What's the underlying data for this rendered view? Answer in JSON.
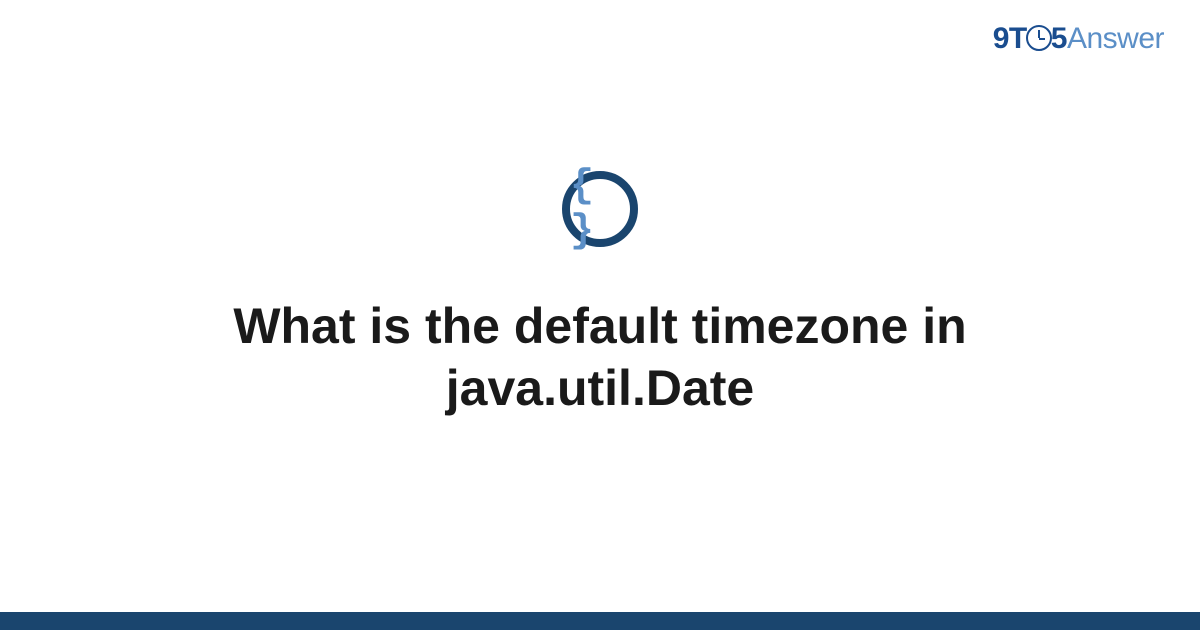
{
  "brand": {
    "segment_9t": "9T",
    "segment_5": "5",
    "segment_answer": "Answer"
  },
  "icon": {
    "glyph": "{ }"
  },
  "question": {
    "title": "What is the default timezone in java.util.Date"
  },
  "colors": {
    "accent_dark": "#1a456e",
    "accent_mid": "#1a4d8f",
    "accent_light": "#5b8fc7"
  }
}
